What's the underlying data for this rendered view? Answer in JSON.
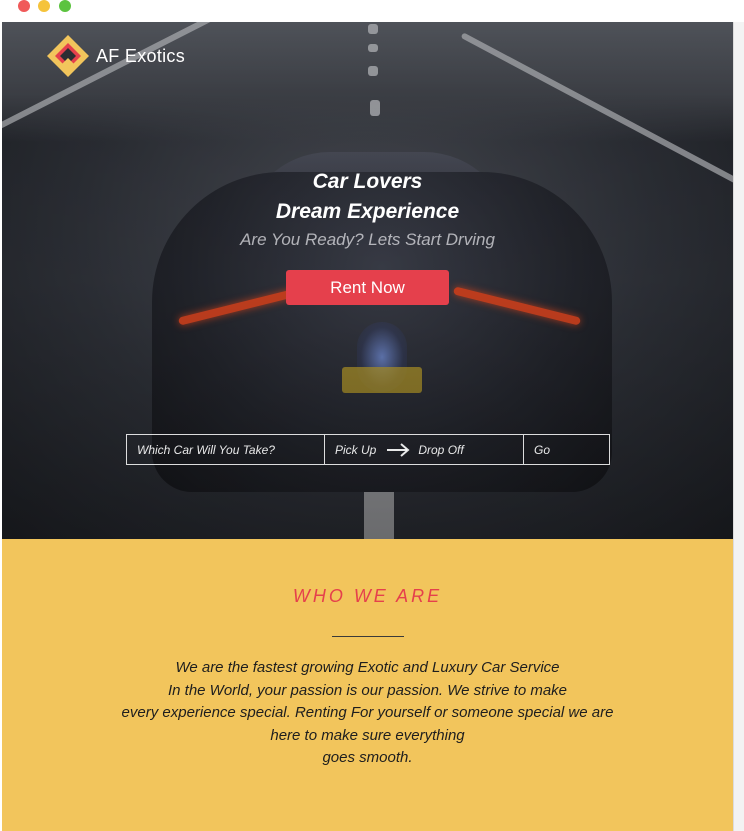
{
  "brand": {
    "name": "AF Exotics",
    "logo_colors": {
      "outer": "#f2c55c",
      "inner": "#e5404c"
    }
  },
  "hero": {
    "headline_line1": "Car Lovers",
    "headline_line2": "Dream Experience",
    "tagline": "Are You Ready? Lets Start Drving",
    "cta_label": "Rent Now"
  },
  "search": {
    "car_placeholder": "Which Car Will You Take?",
    "pickup_label": "Pick Up",
    "dropoff_label": "Drop Off",
    "go_label": "Go",
    "arrow_icon": "arrow-right-icon"
  },
  "about": {
    "title": "WHO WE ARE",
    "lines": [
      "We are the fastest growing Exotic and Luxury Car Service",
      "In the World, your passion is our passion. We strive to make",
      "every experience special. Renting For yourself or someone special we are",
      "here to make sure everything",
      "goes smooth."
    ]
  },
  "colors": {
    "accent": "#e5404c",
    "section_bg": "#f2c55c",
    "text_dark": "#1e1e1e"
  }
}
